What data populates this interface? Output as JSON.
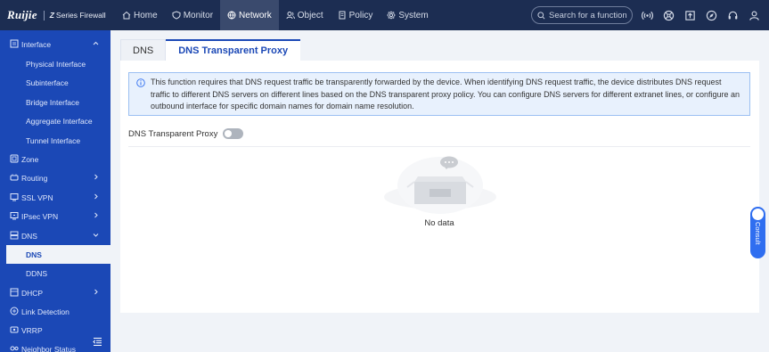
{
  "brand": {
    "logo": "Ruijie",
    "series_letter": "Z",
    "series_text": "Series Firewall"
  },
  "nav": [
    {
      "label": "Home",
      "icon": "home-icon"
    },
    {
      "label": "Monitor",
      "icon": "shield-icon"
    },
    {
      "label": "Network",
      "icon": "globe-icon",
      "active": true
    },
    {
      "label": "Object",
      "icon": "users-icon"
    },
    {
      "label": "Policy",
      "icon": "document-icon"
    },
    {
      "label": "System",
      "icon": "gear-icon"
    }
  ],
  "search": {
    "placeholder": "Search for a function"
  },
  "top_icons": [
    "wireless-icon",
    "network-icon",
    "upload-icon",
    "compass-icon",
    "headset-icon",
    "user-icon"
  ],
  "sidebar": {
    "items": [
      {
        "label": "Interface",
        "icon": "interface-icon",
        "expanded": true
      },
      {
        "label": "Physical Interface",
        "sub": true
      },
      {
        "label": "Subinterface",
        "sub": true
      },
      {
        "label": "Bridge Interface",
        "sub": true
      },
      {
        "label": "Aggregate Interface",
        "sub": true
      },
      {
        "label": "Tunnel Interface",
        "sub": true
      },
      {
        "label": "Zone",
        "icon": "zone-icon"
      },
      {
        "label": "Routing",
        "icon": "routing-icon",
        "chevron": "right"
      },
      {
        "label": "SSL VPN",
        "icon": "ssl-vpn-icon",
        "chevron": "right"
      },
      {
        "label": "IPsec VPN",
        "icon": "ipsec-vpn-icon",
        "chevron": "right"
      },
      {
        "label": "DNS",
        "icon": "dns-icon",
        "chevron": "down"
      },
      {
        "label": "DNS",
        "sub": true,
        "selected": true
      },
      {
        "label": "DDNS",
        "sub": true
      },
      {
        "label": "DHCP",
        "icon": "dhcp-icon",
        "chevron": "right"
      },
      {
        "label": "Link Detection",
        "icon": "link-detection-icon"
      },
      {
        "label": "VRRP",
        "icon": "vrrp-icon"
      },
      {
        "label": "Neighbor Status",
        "icon": "neighbor-icon"
      }
    ]
  },
  "tabs": [
    {
      "label": "DNS"
    },
    {
      "label": "DNS Transparent Proxy",
      "active": true
    }
  ],
  "notice": {
    "text": "This function requires that DNS request traffic be transparently forwarded by the device. When identifying DNS request traffic, the device distributes DNS request traffic to different DNS servers on different lines based on the DNS transparent proxy policy. You can configure DNS servers for different extranet lines, or configure an outbound interface for specific domain names for domain name resolution."
  },
  "toggle": {
    "label": "DNS Transparent Proxy",
    "state": "off"
  },
  "empty": {
    "text": "No data"
  },
  "consult": {
    "label": "Consult"
  },
  "colors": {
    "topbar": "#1c2d52",
    "sidebar": "#1b48b6",
    "accent": "#1b48b6",
    "notice_bg": "#e8f1fd",
    "consult": "#2f6ef0"
  }
}
